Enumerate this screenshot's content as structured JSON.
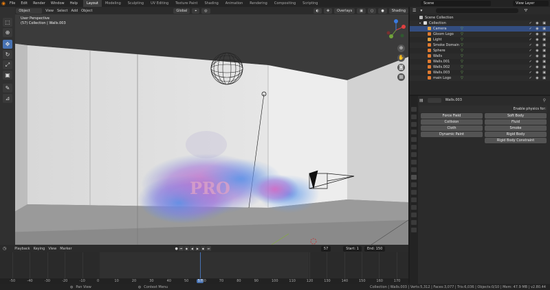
{
  "topbar": {
    "menus": [
      "File",
      "Edit",
      "Render",
      "Window",
      "Help"
    ],
    "workspaces": [
      "Layout",
      "Modeling",
      "Sculpting",
      "UV Editing",
      "Texture Paint",
      "Shading",
      "Animation",
      "Rendering",
      "Compositing",
      "Scripting"
    ],
    "active_workspace": "Layout",
    "scene": "Scene",
    "view_layer": "View Layer"
  },
  "viewport_header": {
    "mode": "Object Mode",
    "menus": [
      "View",
      "Select",
      "Add",
      "Object"
    ],
    "orientation": "Global",
    "overlays": "Overlays",
    "shading": "Shading"
  },
  "viewport": {
    "view_name": "User Perspective",
    "collection_info": "(57) Collection | Walls.003",
    "logo_text": "PRO"
  },
  "outliner": {
    "root": "Scene Collection",
    "collection": "Collection",
    "items": [
      {
        "name": "Camera",
        "color": "#e0a040",
        "selected": true
      },
      {
        "name": "Gloom Logo",
        "color": "#e07a30",
        "selected": false
      },
      {
        "name": "Light",
        "color": "#e0a040",
        "selected": false
      },
      {
        "name": "Smoke Domain",
        "color": "#e07a30",
        "selected": false
      },
      {
        "name": "Sphere",
        "color": "#e07a30",
        "selected": false
      },
      {
        "name": "Walls",
        "color": "#e07a30",
        "selected": false
      },
      {
        "name": "Walls.001",
        "color": "#e07a30",
        "selected": false
      },
      {
        "name": "Walls.002",
        "color": "#e07a30",
        "selected": false
      },
      {
        "name": "Walls.003",
        "color": "#e07a30",
        "selected": false
      },
      {
        "name": "main Logo",
        "color": "#e07a30",
        "selected": false
      }
    ]
  },
  "properties": {
    "object_name": "Walls.003",
    "enable_label": "Enable physics for:",
    "buttons_left": [
      "Force Field",
      "Collision",
      "Cloth",
      "Dynamic Paint"
    ],
    "buttons_right": [
      "Soft Body",
      "Fluid",
      "Smoke",
      "Rigid Body",
      "Rigid Body Constraint"
    ]
  },
  "timeline": {
    "menus": [
      "Playback",
      "Keying",
      "View",
      "Marker"
    ],
    "current_frame": "57",
    "start_label": "Start:",
    "start": "1",
    "end_label": "End:",
    "end": "150",
    "ruler": [
      "-50",
      "-40",
      "-30",
      "-20",
      "-10",
      "0",
      "10",
      "20",
      "30",
      "40",
      "50",
      "57",
      "60",
      "70",
      "80",
      "90",
      "100",
      "110",
      "120",
      "130",
      "140",
      "150",
      "160",
      "170"
    ]
  },
  "statusbar": {
    "left": "Pan View",
    "middle": "Context Menu",
    "right": "Collection | Walls.003 | Verts:5,312 | Faces:3,077 | Tris:6,036 | Objects:0/10 | Mem: 47.9 MB | v2.80.44"
  },
  "colors": {
    "accent": "#4772b3",
    "outliner_selected": "#334d80",
    "orange": "#e87d0d"
  }
}
